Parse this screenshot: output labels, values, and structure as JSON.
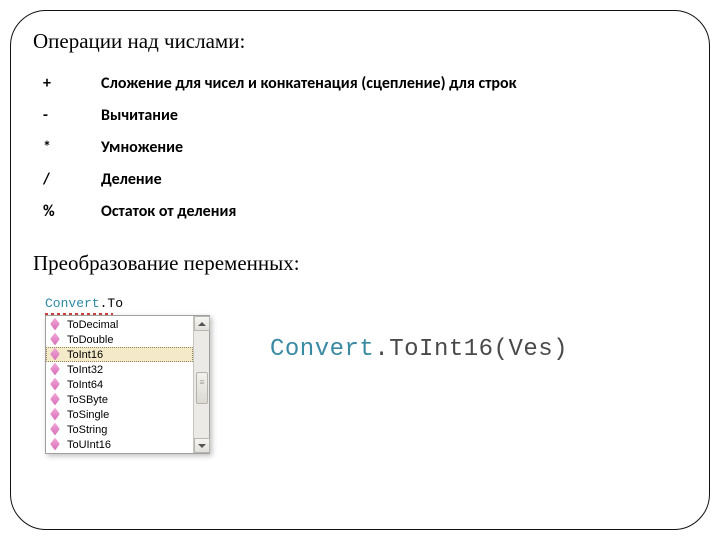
{
  "headings": {
    "ops": "Операции над числами:",
    "conv": "Преобразование переменных:"
  },
  "ops": [
    {
      "sym": "+",
      "desc": "Сложение для чисел и конкатенация (сцепление) для строк"
    },
    {
      "sym": "-",
      "desc": "Вычитание"
    },
    {
      "sym": "*",
      "desc": "Умножение"
    },
    {
      "sym": "/",
      "desc": "Деление"
    },
    {
      "sym": "%",
      "desc": "Остаток от деления"
    }
  ],
  "snippet": {
    "type_part": "Convert",
    "rest": ".To"
  },
  "intellisense": {
    "items": [
      "ToDecimal",
      "ToDouble",
      "ToInt16",
      "ToInt32",
      "ToInt64",
      "ToSByte",
      "ToSingle",
      "ToString",
      "ToUInt16"
    ],
    "selected": "ToInt16"
  },
  "code_large": {
    "type_part": "Convert",
    "rest": ".ToInt16(Ves)"
  }
}
